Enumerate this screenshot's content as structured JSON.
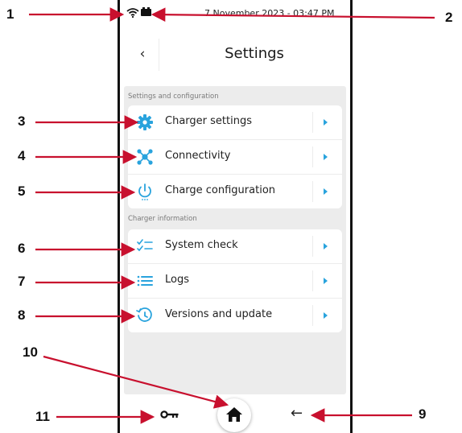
{
  "status_bar": {
    "datetime": "7 November 2023 - 03:47 PM"
  },
  "header": {
    "back_label": "‹",
    "title": "Settings"
  },
  "sections": [
    {
      "label": "Settings and configuration",
      "items": [
        {
          "label": "Charger settings",
          "icon": "gear-icon"
        },
        {
          "label": "Connectivity",
          "icon": "network-icon"
        },
        {
          "label": "Charge configuration",
          "icon": "power-icon"
        }
      ]
    },
    {
      "label": "Charger information",
      "items": [
        {
          "label": "System check",
          "icon": "checklist-icon"
        },
        {
          "label": "Logs",
          "icon": "list-icon"
        },
        {
          "label": "Versions and update",
          "icon": "history-icon"
        }
      ]
    }
  ],
  "bottom_bar": {
    "back_arrow": "←"
  },
  "callouts": [
    "1",
    "2",
    "3",
    "4",
    "5",
    "6",
    "7",
    "8",
    "9",
    "10",
    "11"
  ],
  "colors": {
    "accent": "#29a3dd",
    "callout": "#c8102e"
  }
}
